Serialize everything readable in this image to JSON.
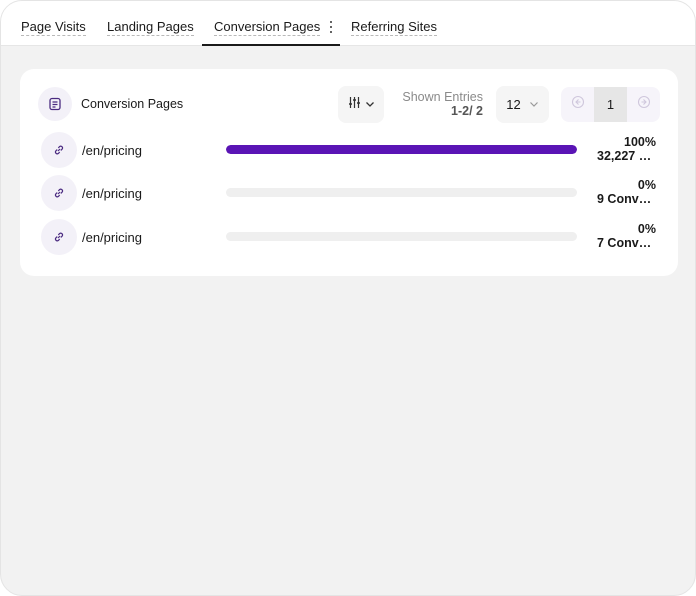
{
  "tabs": [
    {
      "label": "Page Visits",
      "active": false
    },
    {
      "label": "Landing Pages",
      "active": false
    },
    {
      "label": "Conversion Pages",
      "active": true
    },
    {
      "label": "Referring Sites",
      "active": false
    }
  ],
  "card": {
    "icon": "document-list-icon",
    "title": "Conversion Pages",
    "filter_icon": "sliders-icon",
    "entries_label": "Shown Entries",
    "entries_value": "1-2/ 2",
    "per_page": "12",
    "pagination": {
      "current_page": "1"
    }
  },
  "rows": [
    {
      "path": "/en/pricing",
      "percent": "100%",
      "count": "32,227 Conversions",
      "fill": 1.0
    },
    {
      "path": "/en/pricing",
      "percent": "0%",
      "count": "9 Conversions",
      "fill": 0.0
    },
    {
      "path": "/en/pricing",
      "percent": "0%",
      "count": "7 Conversions",
      "fill": 0.0
    }
  ],
  "colors": {
    "accent": "#5a14b5",
    "track": "#efefef",
    "icon_bg": "#f3f1f8"
  }
}
